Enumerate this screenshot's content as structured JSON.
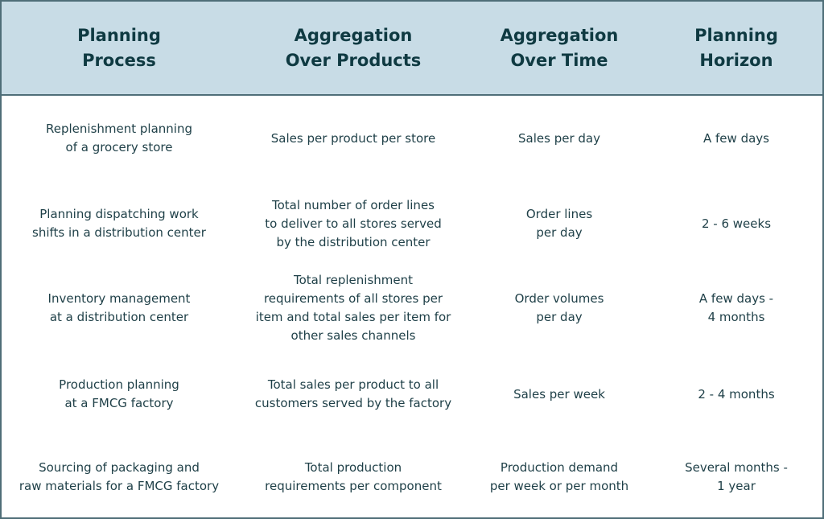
{
  "table": {
    "headers": [
      "Planning\nProcess",
      "Aggregation\nOver Products",
      "Aggregation\nOver Time",
      "Planning\nHorizon"
    ],
    "rows": [
      [
        "Replenishment planning\nof a grocery store",
        "Sales per product per store",
        "Sales per day",
        "A few days"
      ],
      [
        "Planning dispatching work\nshifts in a distribution center",
        "Total number of order lines\nto deliver to all stores served\nby the distribution center",
        "Order lines\nper day",
        "2 - 6 weeks"
      ],
      [
        "Inventory management\nat a distribution center",
        "Total replenishment\nrequirements of all stores per\nitem and total sales per item for\nother sales channels",
        "Order volumes\nper day",
        "A few days -\n4 months"
      ],
      [
        "Production planning\nat a FMCG factory",
        "Total sales per product to all\ncustomers served by the factory",
        "Sales per week",
        "2 - 4 months"
      ],
      [
        "Sourcing of packaging and\nraw materials for a FMCG factory",
        "Total production\nrequirements per component",
        "Production demand\nper week or per month",
        "Several months -\n1 year"
      ]
    ]
  }
}
